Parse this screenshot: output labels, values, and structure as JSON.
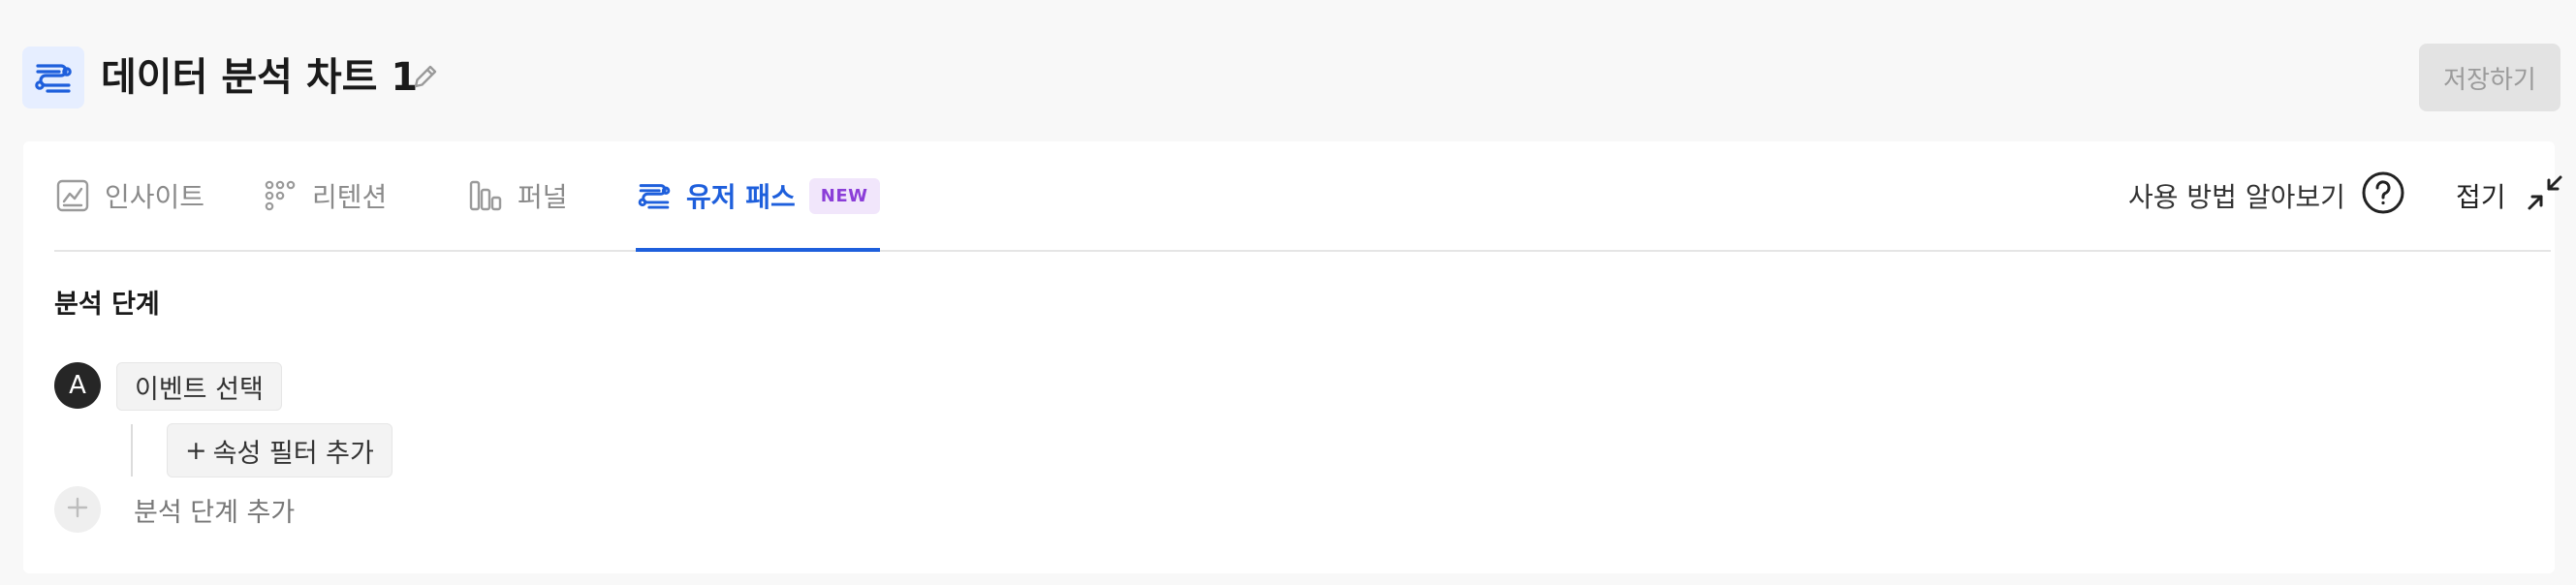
{
  "header": {
    "title": "데이터 분석 차트 1",
    "save_label": "저장하기"
  },
  "tabs": [
    {
      "label": "인사이트",
      "icon": "chart-line-icon",
      "active": false
    },
    {
      "label": "리텐션",
      "icon": "dot-grid-icon",
      "active": false
    },
    {
      "label": "퍼널",
      "icon": "bar-chart-icon",
      "active": false
    },
    {
      "label": "유저 패스",
      "icon": "user-path-icon",
      "active": true,
      "badge": "NEW"
    }
  ],
  "toolbar": {
    "help_label": "사용 방법 알아보기",
    "collapse_label": "접기"
  },
  "analysis": {
    "section_title": "분석 단계",
    "steps": [
      {
        "marker": "A",
        "event_label": "이벤트 선택",
        "filter_label": "속성 필터 추가",
        "filter_prefix": "+"
      }
    ],
    "add_step_label": "분석 단계 추가"
  },
  "colors": {
    "accent": "#1e5fdc",
    "badge_bg": "#f1e6fb",
    "badge_text": "#8b3ed8",
    "disabled_button": "#e3e3e3"
  }
}
